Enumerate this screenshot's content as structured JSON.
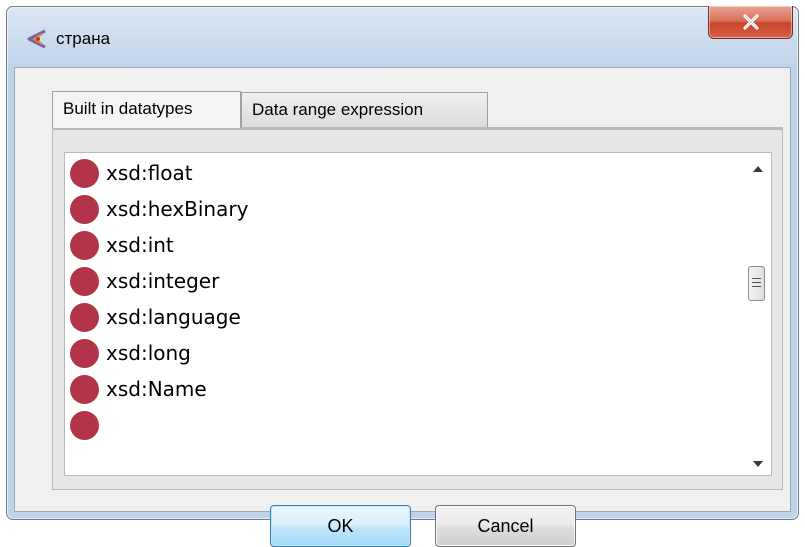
{
  "window": {
    "title": "страна",
    "icon": "protege-app-icon",
    "close_icon": "close-icon"
  },
  "tabs": [
    {
      "label": "Built in datatypes",
      "active": true
    },
    {
      "label": "Data range expression",
      "active": false
    }
  ],
  "datatype_list": {
    "items": [
      {
        "label": "xsd:float"
      },
      {
        "label": "xsd:hexBinary"
      },
      {
        "label": "xsd:int"
      },
      {
        "label": "xsd:integer"
      },
      {
        "label": "xsd:language"
      },
      {
        "label": "xsd:long"
      },
      {
        "label": "xsd:Name"
      },
      {
        "label": ""
      }
    ],
    "item_icon": "datatype-dot-icon",
    "item_color": "#b13448"
  },
  "buttons": {
    "ok_label": "OK",
    "cancel_label": "Cancel"
  },
  "colors": {
    "close_button": "#c7442a",
    "ok_button_border": "#3c7fb1"
  }
}
